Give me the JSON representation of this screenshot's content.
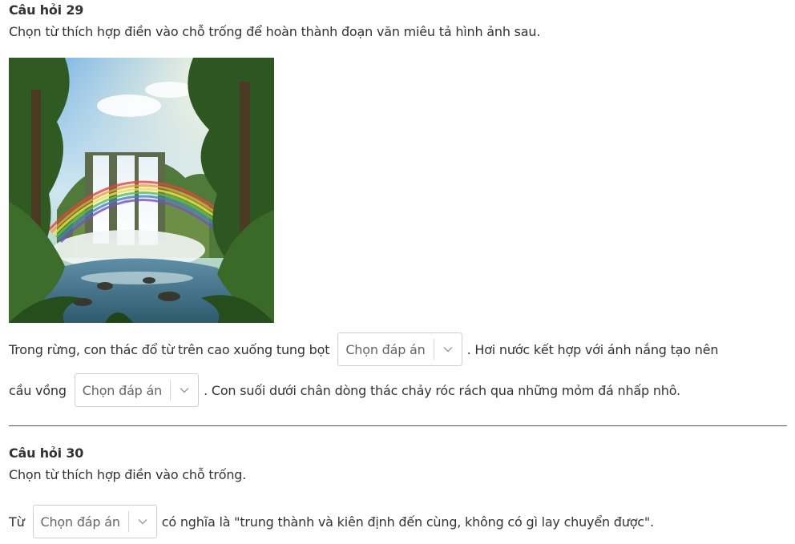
{
  "q29": {
    "title": "Câu hỏi 29",
    "prompt": "Chọn từ thích hợp điền vào chỗ trống để hoàn thành đoạn văn miêu tả hình ảnh sau.",
    "line1_before": "Trong rừng, con thác đổ từ trên cao xuống tung bọt",
    "line1_after": ". Hơi nước kết hợp với ánh nắng tạo nên",
    "line2_before": "cầu vồng",
    "line2_after": ". Con suối dưới chân dòng thác chảy róc rách qua những mỏm đá nhấp nhô.",
    "select1_placeholder": "Chọn đáp án",
    "select2_placeholder": "Chọn đáp án"
  },
  "q30": {
    "title": "Câu hỏi 30",
    "prompt": "Chọn từ thích hợp điền vào chỗ trống.",
    "line_before": "Từ",
    "line_after": "có nghĩa là \"trung thành và kiên định đến cùng, không có gì lay chuyển được\".",
    "select_placeholder": "Chọn đáp án"
  },
  "icons": {
    "dropdown": "chevron-down-icon"
  }
}
